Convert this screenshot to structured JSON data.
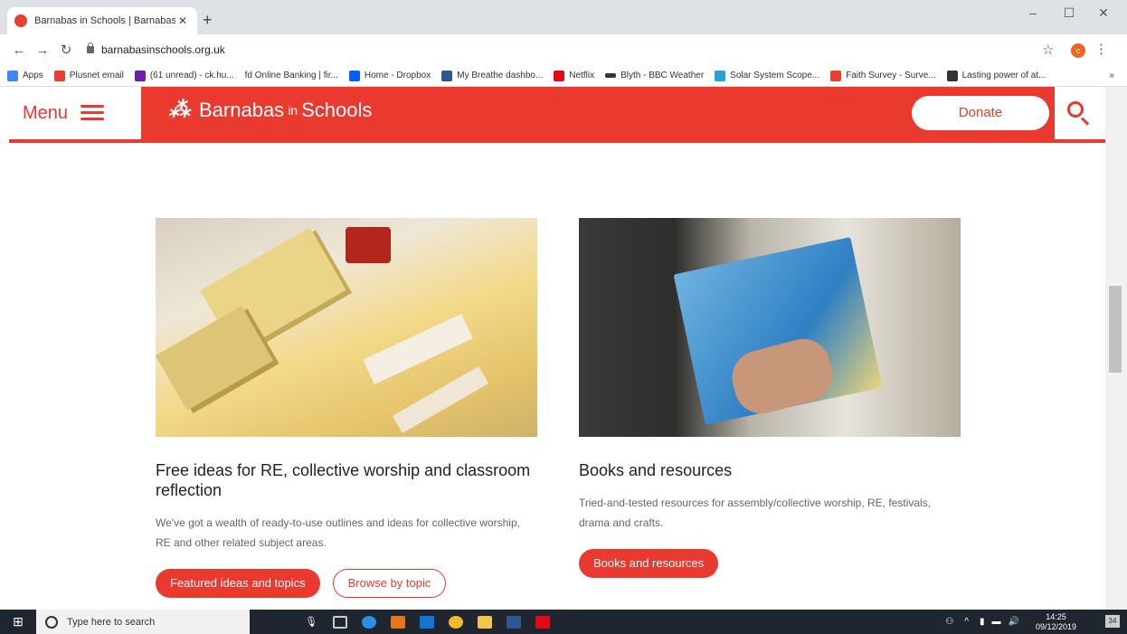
{
  "browser": {
    "tab_title": "Barnabas in Schools | Barnabas i",
    "url": "barnabasinschools.org.uk",
    "profile_initial": "c",
    "bookmarks": [
      {
        "label": "Apps",
        "color": "#4285f4"
      },
      {
        "label": "Plusnet email",
        "color": "#e8402f"
      },
      {
        "label": "(61 unread) - ck.hu...",
        "color": "#6b1fa8"
      },
      {
        "label": "fd Online Banking | fir...",
        "color": "#222222"
      },
      {
        "label": "Home - Dropbox",
        "color": "#0061ff"
      },
      {
        "label": "My Breathe dashbo...",
        "color": "#2b5797"
      },
      {
        "label": "Netflix",
        "color": "#e50914"
      },
      {
        "label": "Blyth - BBC Weather",
        "color": "#333333"
      },
      {
        "label": "Solar System Scope...",
        "color": "#2aa0d8"
      },
      {
        "label": "Faith Survey - Surve...",
        "color": "#e8402f"
      },
      {
        "label": "Lasting power of at...",
        "color": "#333333"
      }
    ]
  },
  "site": {
    "menu_label": "Menu",
    "logo_text": "Barnabas",
    "logo_in": "in",
    "logo_text2": "Schools",
    "donate_label": "Donate",
    "brand_color": "#ea3a30"
  },
  "cards": [
    {
      "title": "Free ideas for RE, collective worship and classroom reflection",
      "text": "We've got a wealth of ready-to-use outlines and ideas for collective worship, RE and other related subject areas.",
      "primary": "Featured ideas and topics",
      "secondary": "Browse by topic"
    },
    {
      "title": "Books and resources",
      "text": "Tried-and-tested resources for assembly/collective worship, RE, festivals, drama and crafts.",
      "primary": "Books and resources"
    }
  ],
  "taskbar": {
    "search_placeholder": "Type here to search",
    "time": "14:25",
    "date": "09/12/2019",
    "notifications": "34"
  }
}
